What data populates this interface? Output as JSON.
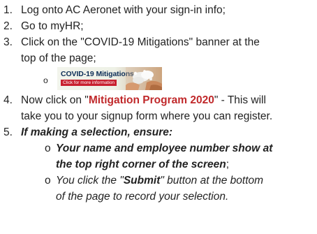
{
  "steps": [
    {
      "num": "1.",
      "text": "Log onto AC Aeronet with your sign-in info;"
    },
    {
      "num": "2.",
      "text": "Go to myHR;"
    },
    {
      "num": "3.",
      "line1": "Click on the \"COVID-19 Mitigations\" banner at the",
      "line2": "top of the page;"
    },
    {
      "num": "4.",
      "pre": "Now click on \"",
      "link": "Mitigation Program 2020",
      "post": "\" - This will",
      "line2": "take you to your signup form where you can register."
    },
    {
      "num": "5.",
      "text": "If making a selection, ensure:"
    }
  ],
  "banner": {
    "bullet": "o",
    "title": "COVID-19 Mitigations",
    "cta": "Click for more information",
    "image": "hands-washing-illustration"
  },
  "sub_items": [
    {
      "bullet": "o",
      "line1": "Your name and employee number show at",
      "line2": "the top right corner of the screen",
      "line2_tail": ";"
    },
    {
      "bullet": "o",
      "pre": "You click the \"",
      "bold": "Submit",
      "post": "\" button at the bottom",
      "line2": "of the page to record your selection."
    }
  ],
  "colors": {
    "text": "#222222",
    "link": "#c0292b",
    "banner_title": "#0c2e57",
    "banner_cta_bg": "#c8202f"
  }
}
